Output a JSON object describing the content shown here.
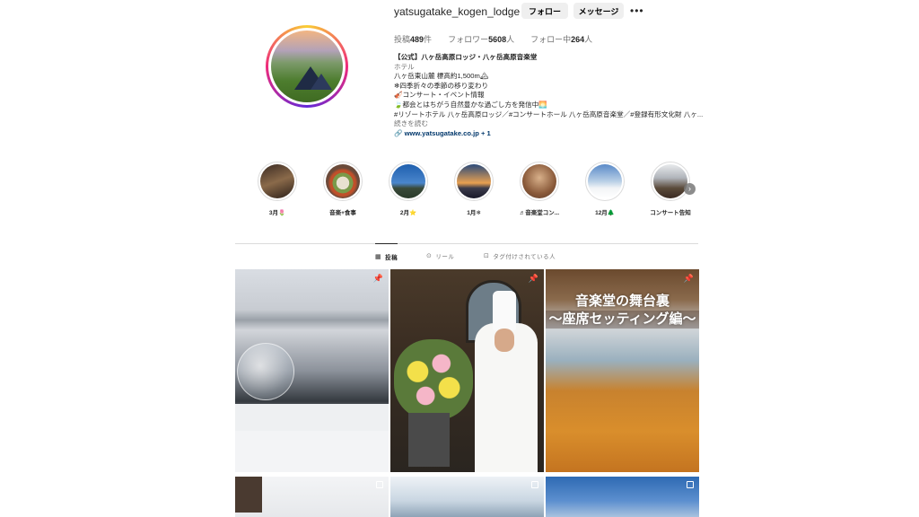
{
  "profile": {
    "username": "yatsugatake_kogen_lodge",
    "follow_label": "フォロー",
    "message_label": "メッセージ",
    "more_label": "•••",
    "stats": {
      "posts_label": "投稿",
      "posts_value": "489",
      "posts_suffix": "件",
      "followers_label": "フォロワー",
      "followers_value": "5608",
      "followers_suffix": "人",
      "following_label": "フォロー中",
      "following_value": "264",
      "following_suffix": "人"
    },
    "bio": {
      "name": "【公式】八ヶ岳高原ロッジ・八ヶ岳高原音楽堂",
      "category": "ホテル",
      "line1": "八ヶ岳東山麓 標高約1,500m🏔",
      "line2": "❄四季折々の季節の移り変わり",
      "line3": "🎻コンサート・イベント情報",
      "line4": "🍃都会とはちがう自然豊かな過ごし方を発信中🌅",
      "line5": "#リゾートホテル 八ヶ岳高原ロッジ／#コンサートホール 八ヶ岳高原音楽堂／#登録有形文化財 八ヶ...",
      "more": "続きを読む",
      "link": "www.yatsugatake.co.jp",
      "link_extra": "+ 1"
    }
  },
  "highlights": [
    {
      "label": "3月🌷"
    },
    {
      "label": "音楽+食事"
    },
    {
      "label": "2月⭐"
    },
    {
      "label": "1月❄"
    },
    {
      "label": "♬音楽堂コン..."
    },
    {
      "label": "12月🌲"
    },
    {
      "label": "コンサート告知"
    }
  ],
  "tabs": {
    "posts": "投稿",
    "reels": "リール",
    "tagged": "タグ付けされている人"
  },
  "posts": {
    "p3_caption_line1": "音楽堂の舞台裏",
    "p3_caption_line2": "〜座席セッティング編〜"
  },
  "icons": {
    "pin": "pin-icon",
    "multi": "multi-image-icon",
    "grid": "grid-icon",
    "reels": "reels-icon",
    "tagged": "tag-icon",
    "link": "link-icon",
    "more": "more-icon"
  }
}
